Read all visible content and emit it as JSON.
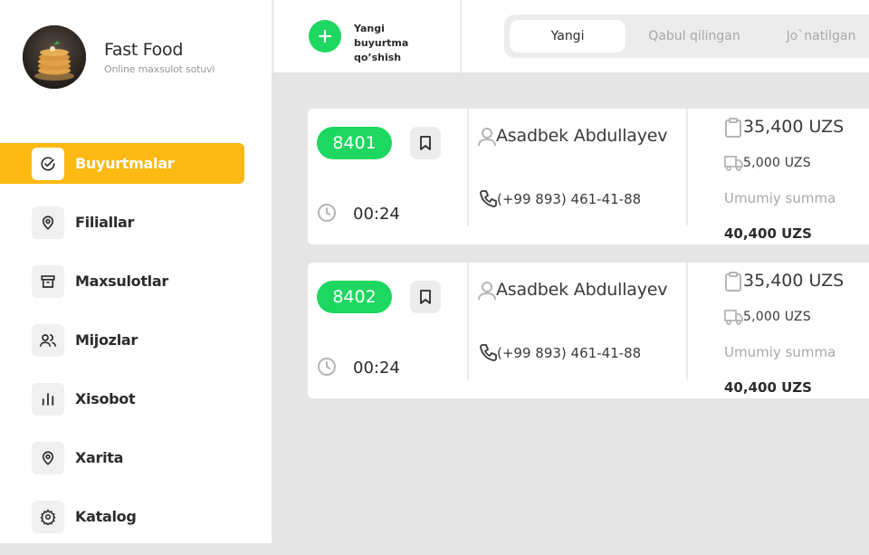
{
  "brand": {
    "title": "Fast Food",
    "subtitle": "Online maxsulot sotuvi"
  },
  "nav": [
    {
      "label": "Buyurtmalar",
      "icon": "check-circle-icon",
      "active": true
    },
    {
      "label": "Filiallar",
      "icon": "location-pin-icon",
      "active": false
    },
    {
      "label": "Maxsulotlar",
      "icon": "archive-box-icon",
      "active": false
    },
    {
      "label": "Mijozlar",
      "icon": "users-icon",
      "active": false
    },
    {
      "label": "Xisobot",
      "icon": "bar-chart-icon",
      "active": false
    },
    {
      "label": "Xarita",
      "icon": "map-pin-icon",
      "active": false
    },
    {
      "label": "Katalog",
      "icon": "gear-icon",
      "active": false
    }
  ],
  "topbar": {
    "new_order_label": "Yangi buyurtma qo’shish",
    "tabs": [
      {
        "label": "Yangi",
        "active": true
      },
      {
        "label": "Qabul qilingan",
        "active": false
      },
      {
        "label": "Jo`natilgan",
        "active": false
      }
    ]
  },
  "orders": [
    {
      "id": "8401",
      "time": "00:24",
      "customer": "Asadbek Abdullayev",
      "phone": "(+99 893) 461-41-88",
      "amount": "35,400 UZS",
      "delivery": "5,000 UZS",
      "total_label": "Umumiy summa",
      "total": "40,400 UZS"
    },
    {
      "id": "8402",
      "time": "00:24",
      "customer": "Asadbek Abdullayev",
      "phone": "(+99 893) 461-41-88",
      "amount": "35,400 UZS",
      "delivery": "5,000 UZS",
      "total_label": "Umumiy summa",
      "total": "40,400 UZS"
    }
  ],
  "colors": {
    "accent": "#fdb913",
    "success": "#1ed760",
    "background": "#e5e5e5"
  }
}
